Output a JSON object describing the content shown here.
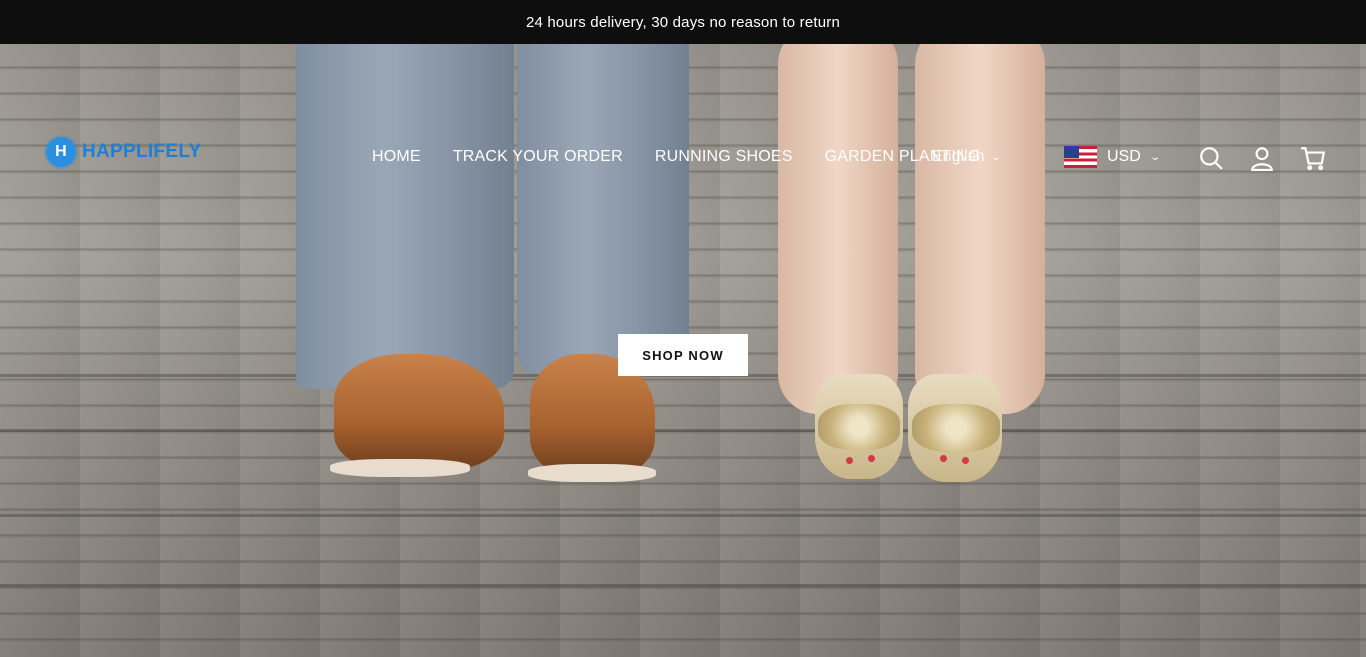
{
  "announcement": {
    "text": "24 hours delivery, 30 days no reason to return"
  },
  "header": {
    "logo_text": "HAPPLIFELY",
    "logo_mark": "H",
    "nav": [
      {
        "label": "HOME"
      },
      {
        "label": "TRACK YOUR ORDER"
      },
      {
        "label": "RUNNING SHOES"
      },
      {
        "label": "GARDEN PLANTING"
      }
    ],
    "language": "English",
    "currency": "USD",
    "icons": [
      "search-icon",
      "account-icon",
      "cart-icon",
      "chevron-down-icon",
      "us-flag-icon"
    ]
  },
  "hero": {
    "cta_label": "SHOP NOW"
  },
  "colors": {
    "announce_bg": "#0e0e0e",
    "logo_blue": "#1e7fd6",
    "cta_bg": "#ffffff"
  }
}
